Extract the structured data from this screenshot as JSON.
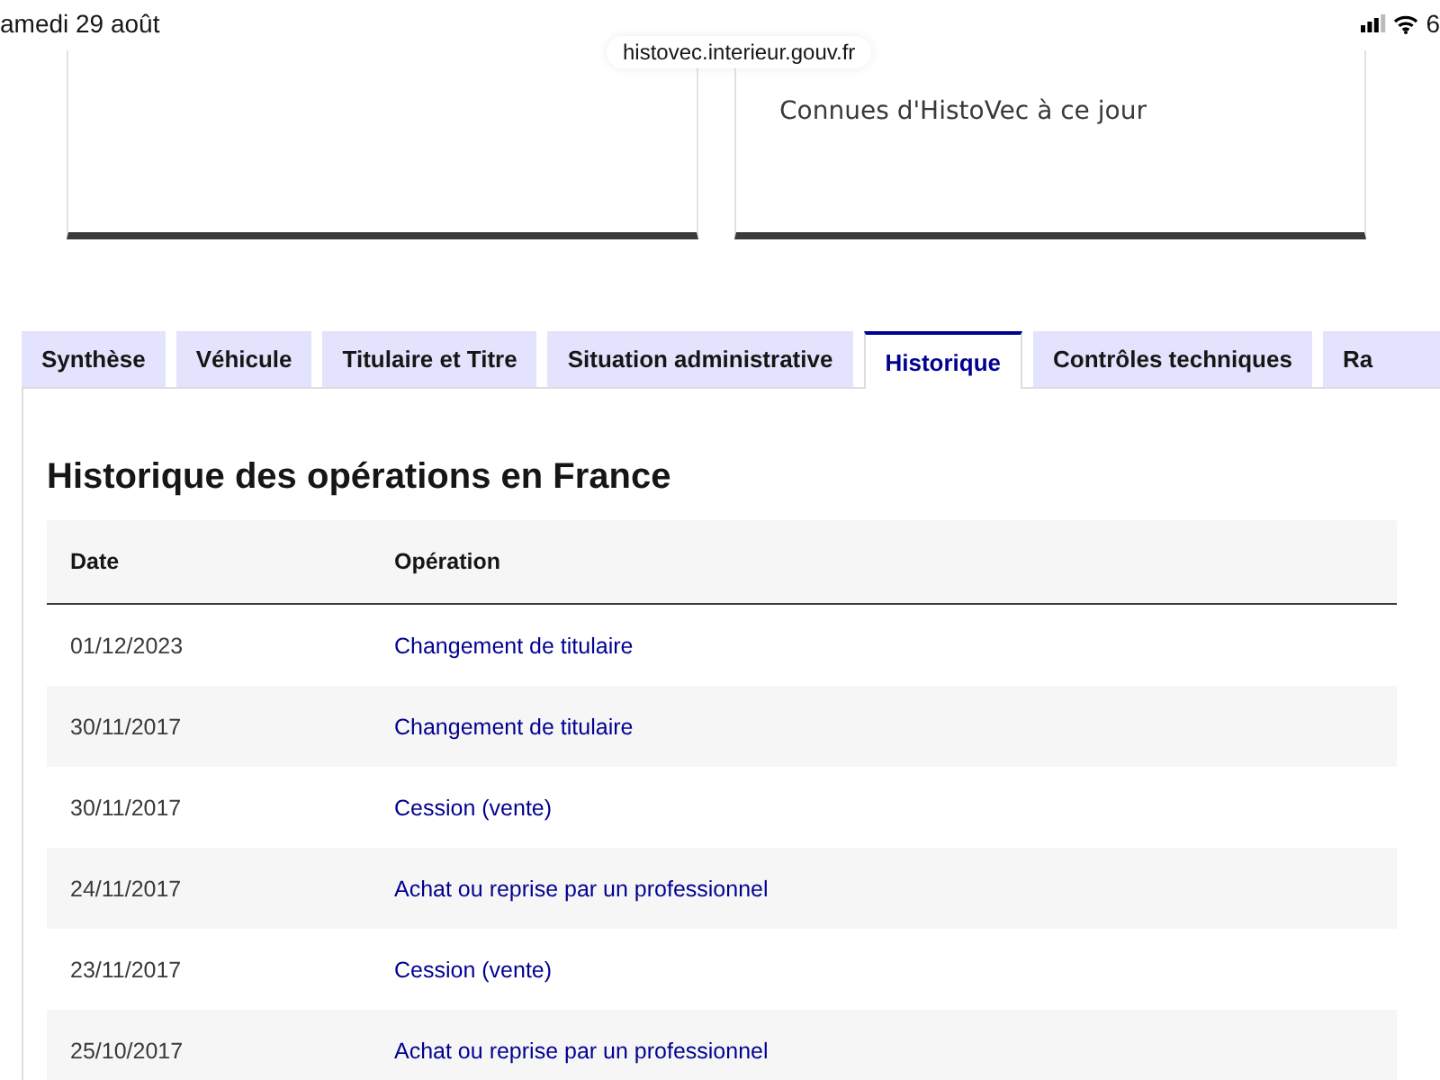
{
  "status_bar": {
    "date": "amedi 29 août",
    "battery": "6"
  },
  "address_bar": {
    "url": "histovec.interieur.gouv.fr"
  },
  "cards": [
    {
      "kind": "empty"
    },
    {
      "kind": "text",
      "text": "Connues d'HistoVec à ce jour"
    }
  ],
  "tabs": [
    {
      "label": "Synthèse",
      "selected": false
    },
    {
      "label": "Véhicule",
      "selected": false
    },
    {
      "label": "Titulaire et Titre",
      "selected": false
    },
    {
      "label": "Situation administrative",
      "selected": false
    },
    {
      "label": "Historique",
      "selected": true
    },
    {
      "label": "Contrôles techniques",
      "selected": false
    },
    {
      "label": "Ra",
      "selected": false
    }
  ],
  "section_title": "Historique des opérations en France",
  "table": {
    "columns": [
      "Date",
      "Opération"
    ],
    "rows": [
      [
        "01/12/2023",
        "Changement de titulaire"
      ],
      [
        "30/11/2017",
        "Changement de titulaire"
      ],
      [
        "30/11/2017",
        "Cession (vente)"
      ],
      [
        "24/11/2017",
        "Achat ou reprise par un professionnel"
      ],
      [
        "23/11/2017",
        "Cession (vente)"
      ],
      [
        "25/10/2017",
        "Achat ou reprise par un professionnel"
      ]
    ]
  }
}
